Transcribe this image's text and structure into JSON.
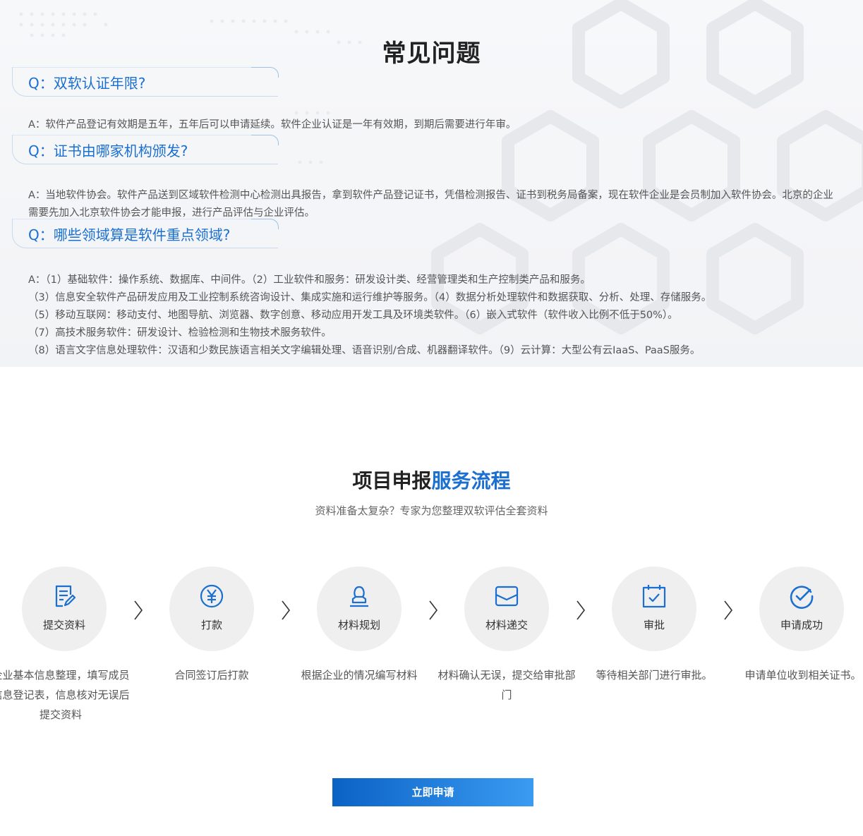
{
  "faq": {
    "title": "常见问题",
    "items": [
      {
        "q": "Q：双软认证年限?",
        "a": [
          "A：软件产品登记有效期是五年，五年后可以申请延续。软件企业认证是一年有效期，到期后需要进行年审。"
        ]
      },
      {
        "q": "Q：证书由哪家机构颁发?",
        "a": [
          "A：当地软件协会。软件产品送到区域软件检测中心检测出具报告，拿到软件产品登记证书，凭借检测报告、证书到税务局备案，现在软件企业是会员制加入软件协会。北京的企业需要先加入北京软件协会才能申报，进行产品评估与企业评估。"
        ]
      },
      {
        "q": "Q：哪些领域算是软件重点领域?",
        "a": [
          "A：（1）基础软件：操作系统、数据库、中间件。（2）工业软件和服务：研发设计类、经营管理类和生产控制类产品和服务。",
          "（3）信息安全软件产品研发应用及工业控制系统咨询设计、集成实施和运行维护等服务。（4）数据分析处理软件和数据获取、分析、处理、存储服务。",
          "（5）移动互联网：移动支付、地图导航、浏览器、数字创意、移动应用开发工具及环境类软件。（6）嵌入式软件（软件收入比例不低于50%）。",
          "（7）高技术服务软件：研发设计、检验检测和生物技术服务软件。",
          "（8）语言文字信息处理软件：汉语和少数民族语言相关文字编辑处理、语音识别/合成、机器翻译软件。（9）云计算：大型公有云IaaS、PaaS服务。"
        ]
      }
    ]
  },
  "process": {
    "title_prefix": "项目申报",
    "title_highlight": "服务流程",
    "subtitle": "资料准备太复杂？专家为您整理双软评估全套资料",
    "steps": [
      {
        "label": "提交资料",
        "icon": "document-edit-icon",
        "desc": "企业基本信息整理，填写成员信息登记表，信息核对无误后提交资料"
      },
      {
        "label": "打款",
        "icon": "yen-coin-icon",
        "desc": "合同签订后打款"
      },
      {
        "label": "材料规划",
        "icon": "stamp-icon",
        "desc": "根据企业的情况编写材料"
      },
      {
        "label": "材料递交",
        "icon": "envelope-icon",
        "desc": "材料确认无误，提交给审批部门"
      },
      {
        "label": "审批",
        "icon": "calendar-check-icon",
        "desc": "等待相关部门进行审批。"
      },
      {
        "label": "申请成功",
        "icon": "circle-check-icon",
        "desc": "申请单位收到相关证书。"
      }
    ],
    "apply_button": "立即申请"
  },
  "colors": {
    "accent": "#1a6fd0",
    "circle_bg": "#efefef",
    "button_start": "#0b62c5",
    "button_end": "#3a9bf2"
  }
}
